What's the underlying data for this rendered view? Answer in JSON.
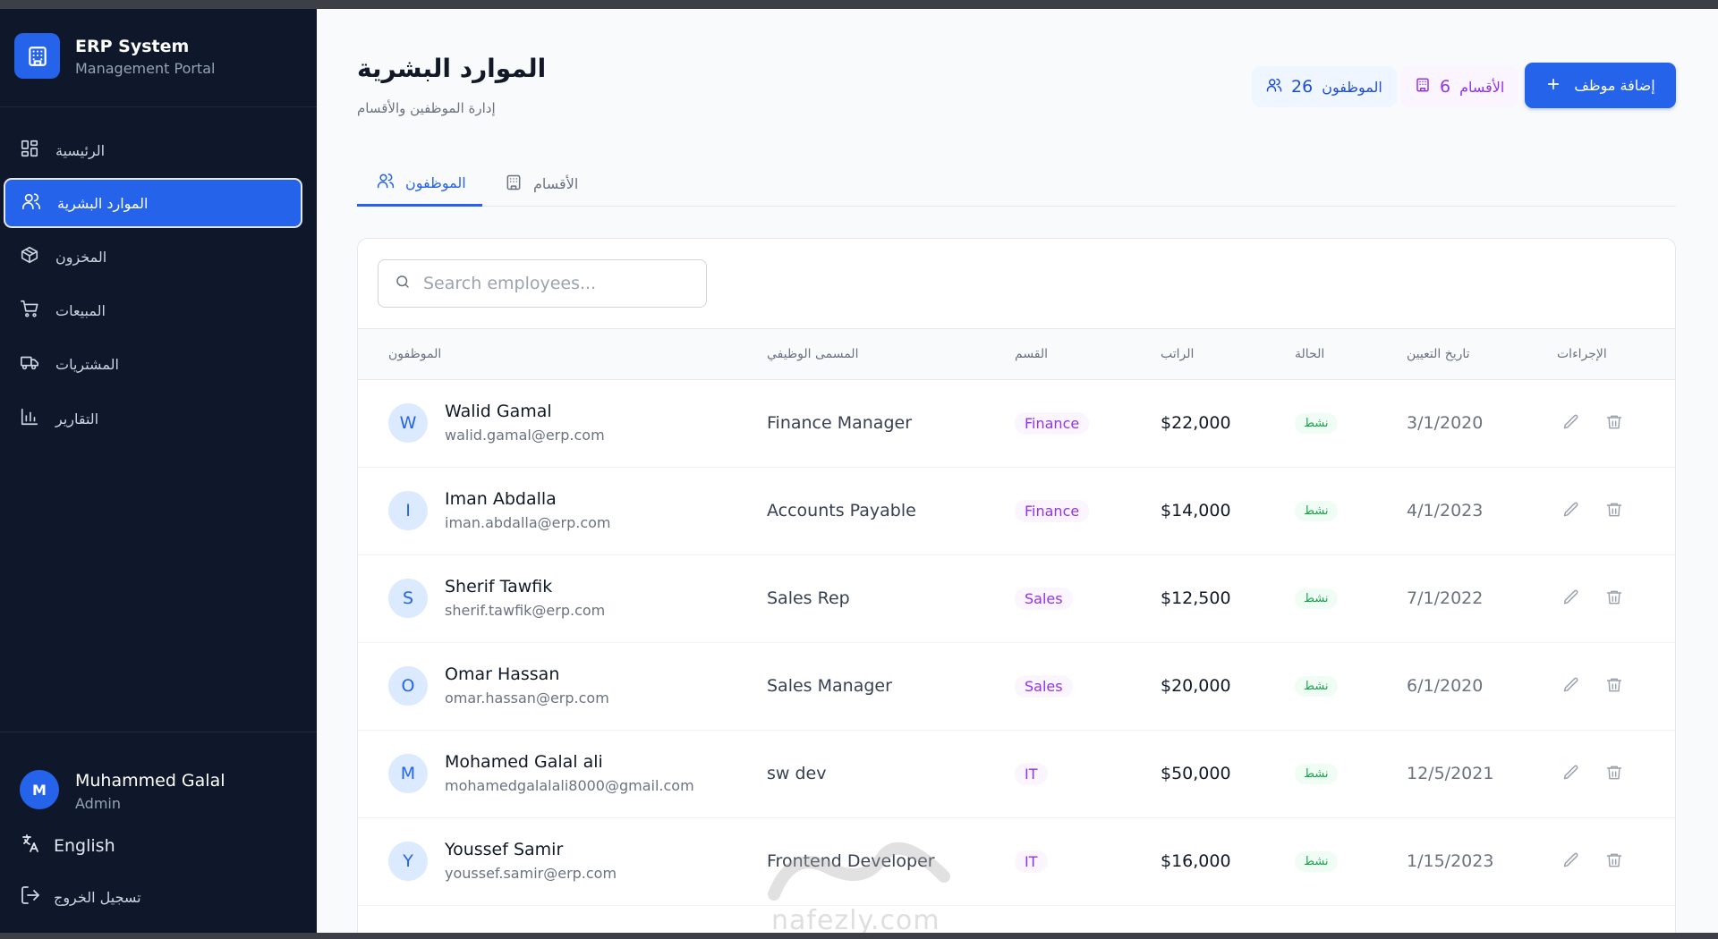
{
  "brand": {
    "title": "ERP System",
    "subtitle": "Management Portal"
  },
  "sidebar": {
    "items": [
      {
        "label": "الرئيسية",
        "icon": "dashboard-icon",
        "active": false
      },
      {
        "label": "الموارد البشرية",
        "icon": "users-icon",
        "active": true
      },
      {
        "label": "المخزون",
        "icon": "package-icon",
        "active": false
      },
      {
        "label": "المبيعات",
        "icon": "cart-icon",
        "active": false
      },
      {
        "label": "المشتريات",
        "icon": "truck-icon",
        "active": false
      },
      {
        "label": "التقارير",
        "icon": "bar-chart-icon",
        "active": false
      }
    ]
  },
  "user": {
    "initial": "M",
    "name": "Muhammed Galal",
    "role": "Admin"
  },
  "language_label": "English",
  "logout_label": "تسجيل الخروج",
  "header": {
    "title": "الموارد البشرية",
    "subtitle": "إدارة الموظفين والأقسام",
    "employees_count": "26",
    "employees_label": "الموظفون",
    "departments_count": "6",
    "departments_label": "الأقسام",
    "add_button": "إضافة موظف"
  },
  "tabs": [
    {
      "label": "الموظفون",
      "active": true
    },
    {
      "label": "الأقسام",
      "active": false
    }
  ],
  "search": {
    "placeholder": "Search employees..."
  },
  "table": {
    "columns": [
      "الموظفون",
      "المسمى الوظيفي",
      "القسم",
      "الراتب",
      "الحالة",
      "تاريخ التعيين",
      "الإجراءات"
    ],
    "rows": [
      {
        "initial": "W",
        "name": "Walid Gamal",
        "email": "walid.gamal@erp.com",
        "position": "Finance Manager",
        "department": "Finance",
        "salary": "$22,000",
        "status": "نشط",
        "hire_date": "3/1/2020"
      },
      {
        "initial": "I",
        "name": "Iman Abdalla",
        "email": "iman.abdalla@erp.com",
        "position": "Accounts Payable",
        "department": "Finance",
        "salary": "$14,000",
        "status": "نشط",
        "hire_date": "4/1/2023"
      },
      {
        "initial": "S",
        "name": "Sherif Tawfik",
        "email": "sherif.tawfik@erp.com",
        "position": "Sales Rep",
        "department": "Sales",
        "salary": "$12,500",
        "status": "نشط",
        "hire_date": "7/1/2022"
      },
      {
        "initial": "O",
        "name": "Omar Hassan",
        "email": "omar.hassan@erp.com",
        "position": "Sales Manager",
        "department": "Sales",
        "salary": "$20,000",
        "status": "نشط",
        "hire_date": "6/1/2020"
      },
      {
        "initial": "M",
        "name": "Mohamed Galal ali",
        "email": "mohamedgalalali8000@gmail.com",
        "position": "sw dev",
        "department": "IT",
        "salary": "$50,000",
        "status": "نشط",
        "hire_date": "12/5/2021"
      },
      {
        "initial": "Y",
        "name": "Youssef Samir",
        "email": "youssef.samir@erp.com",
        "position": "Frontend Developer",
        "department": "IT",
        "salary": "$16,000",
        "status": "نشط",
        "hire_date": "1/15/2023"
      }
    ]
  },
  "watermark": "nafezly.com",
  "colors": {
    "sidebar_bg": "#0f172a",
    "accent": "#2563eb",
    "dept_badge": "#9333ea",
    "status_active": "#16a34a"
  }
}
